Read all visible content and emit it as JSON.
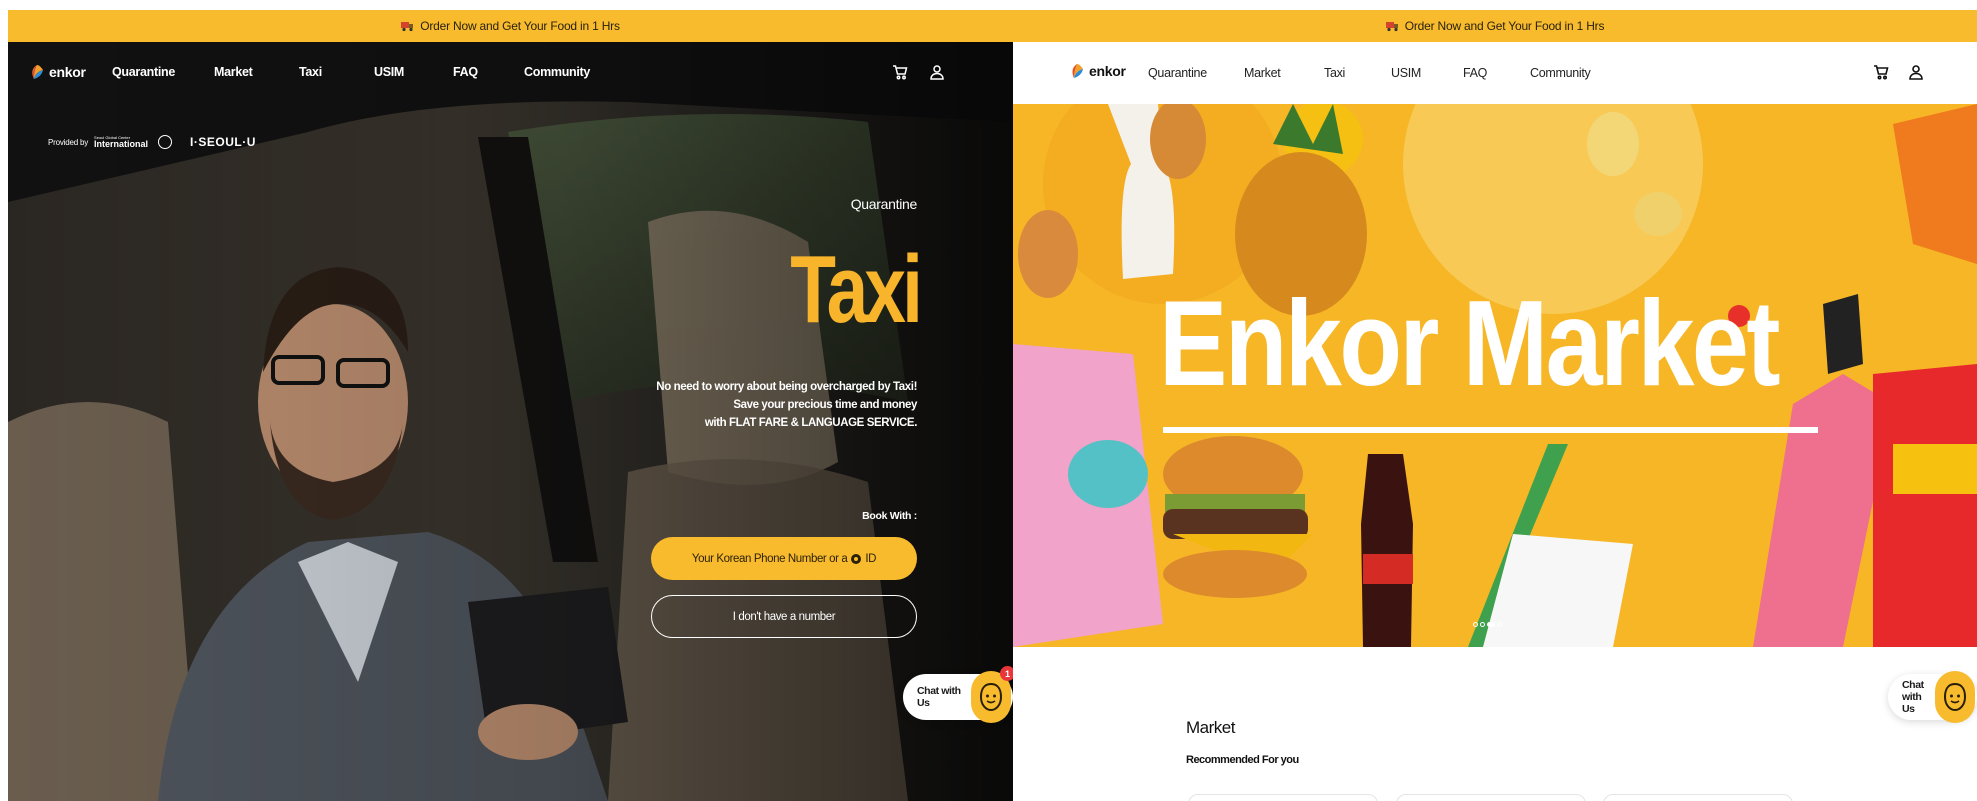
{
  "announcement": {
    "text": "Order Now and Get Your Food in 1 Hrs",
    "icon": "delivery-truck-icon"
  },
  "brand": {
    "name": "enkor",
    "accent": "#f8bb2d",
    "dark": "#1c1a18"
  },
  "nav": {
    "items": [
      "Quarantine",
      "Market",
      "Taxi",
      "USIM",
      "FAQ",
      "Community"
    ],
    "cart_icon": "cart-icon",
    "user_icon": "user-icon"
  },
  "taxi_page": {
    "provided_by": "Provided by",
    "provider_org": "International",
    "provider_org_small": "Seoul Global Center",
    "seoul_logo": "I·SEOUL·U",
    "eyebrow": "Quarantine",
    "title": "Taxi",
    "description": [
      "No need to worry about being overcharged by Taxi!",
      "Save your precious time and money",
      "with FLAT FARE & LANGUAGE SERVICE."
    ],
    "book_with": "Book With :",
    "primary_button_prefix": "Your Korean Phone Number or a",
    "primary_button_suffix": "ID",
    "secondary_button": "I don't have a number",
    "chat_label": "Chat with Us",
    "chat_badge": "1"
  },
  "market_page": {
    "banner_title": "Enkor Market",
    "carousel": {
      "slides": 4,
      "active": 3
    },
    "section_title": "Market",
    "section_subtitle": "Recommended For you",
    "chat_label": "Chat with Us"
  }
}
